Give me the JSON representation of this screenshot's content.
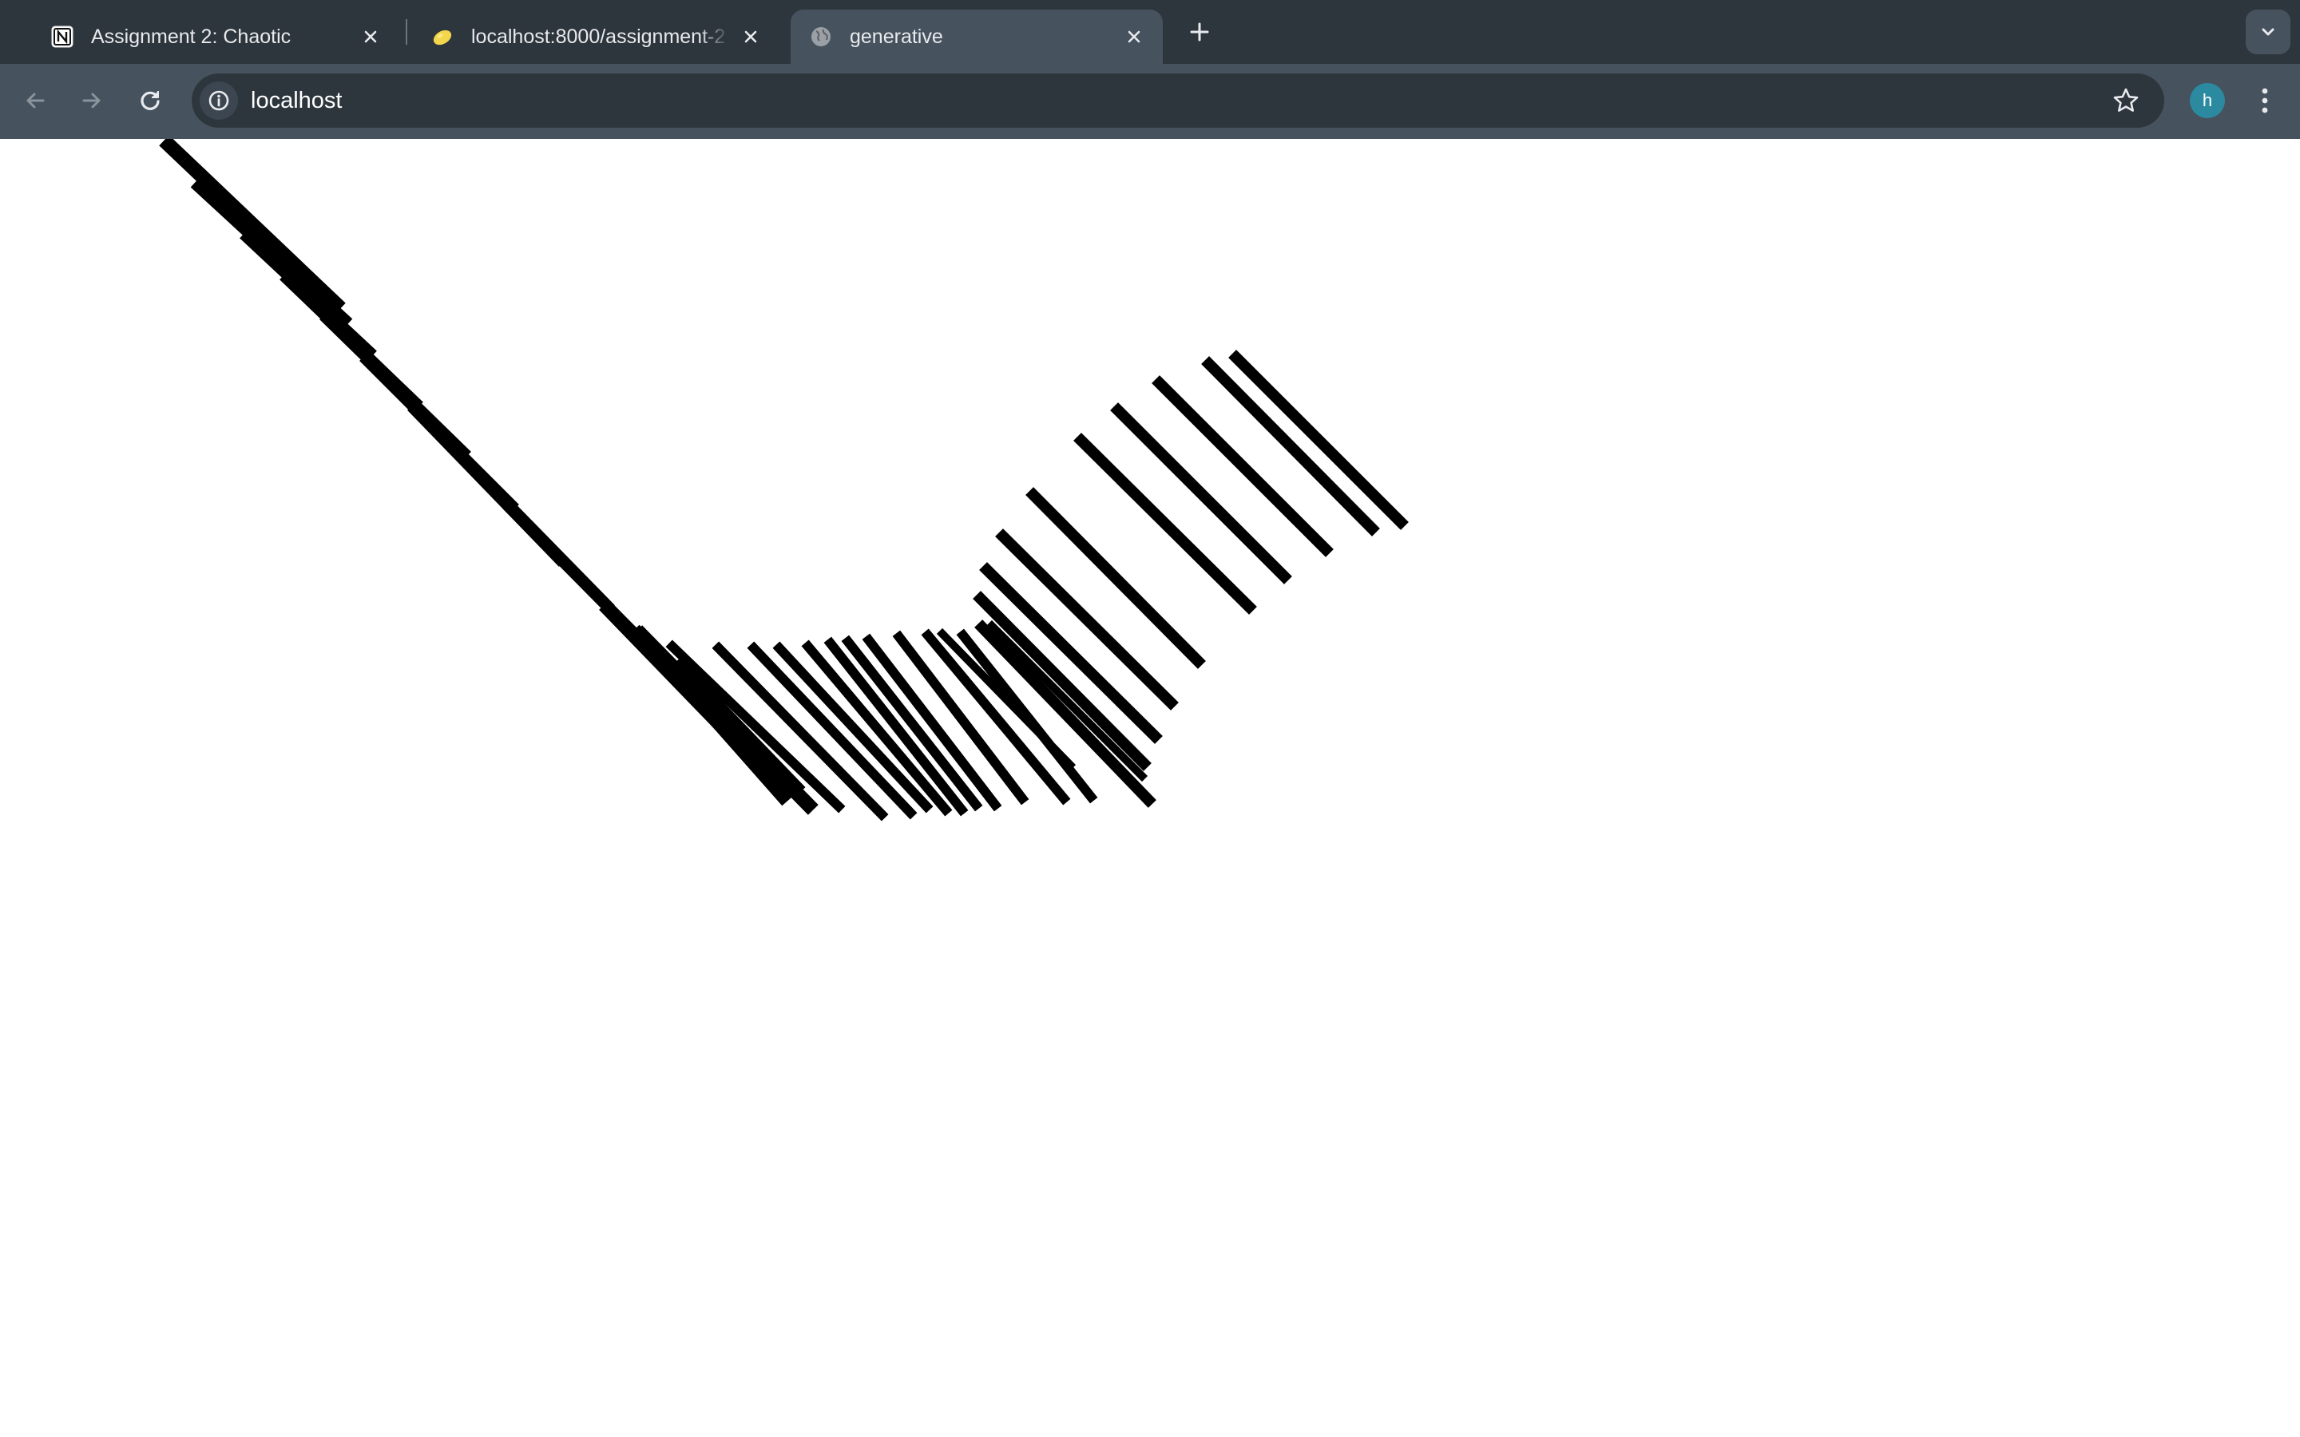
{
  "browser": {
    "tabs": [
      {
        "title": "Assignment 2: Chaotic",
        "favicon": "notion-icon",
        "active": false
      },
      {
        "title": "localhost:8000/assignment-2",
        "favicon": "lemon-icon",
        "active": false
      },
      {
        "title": "generative",
        "favicon": "globe-icon",
        "active": true
      }
    ],
    "address_bar": {
      "url": "localhost"
    },
    "profile": {
      "initial": "h",
      "color": "#2b8aa0"
    }
  },
  "colors": {
    "chrome_dark": "#2e363d",
    "chrome_light": "#46525d",
    "stroke": "#000000"
  }
}
